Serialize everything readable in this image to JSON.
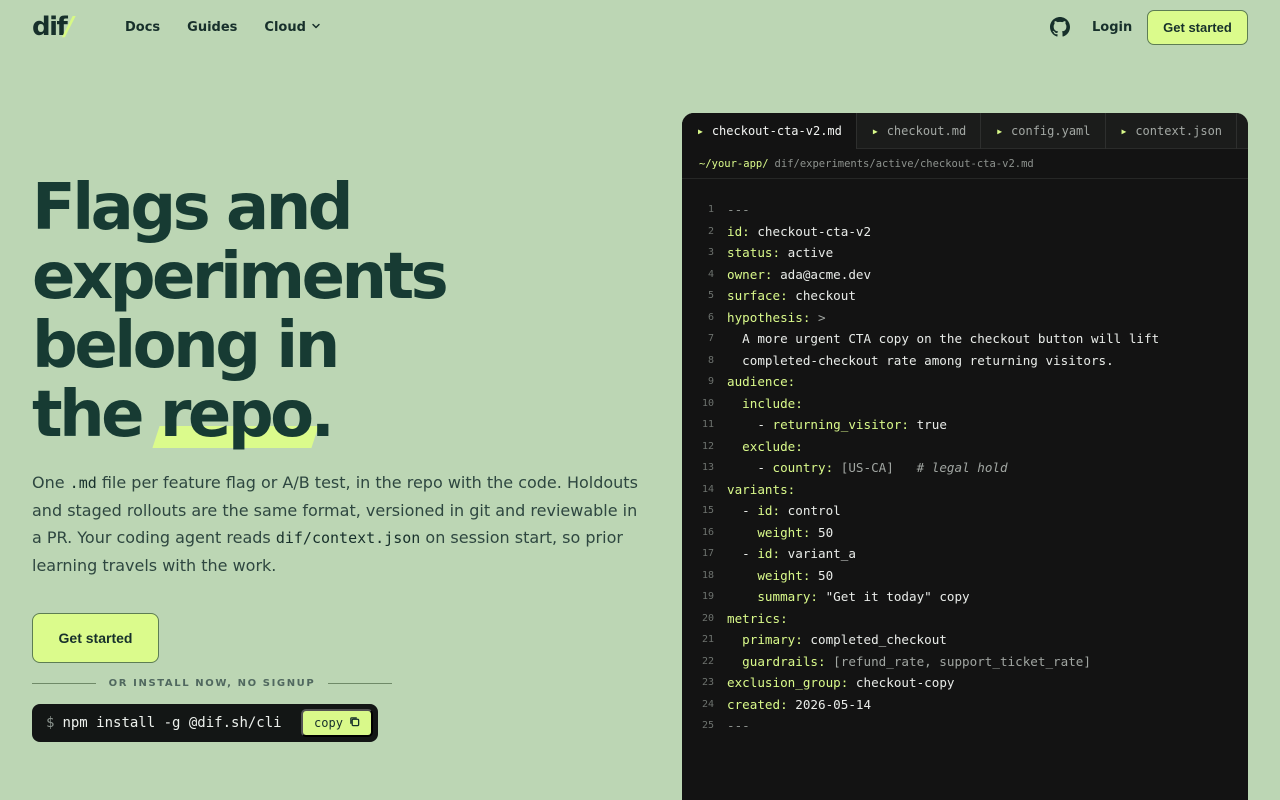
{
  "nav": {
    "logo": "dif",
    "logo_slash": "/",
    "links": [
      "Docs",
      "Guides",
      "Cloud"
    ],
    "login": "Login",
    "cta": "Get started",
    "github_icon": "github-icon"
  },
  "hero": {
    "title_lines": [
      "Flags and",
      "experiments",
      "belong in",
      "the "
    ],
    "title_highlight": "repo",
    "title_end": ".",
    "desc_1": "One ",
    "desc_code_1": ".md",
    "desc_2": " file per feature flag or A/B test, in the repo with the code. Holdouts and staged rollouts are the same format, versioned in git and reviewable in a PR. Your coding agent reads ",
    "desc_code_2": "dif/context.json",
    "desc_3": " on session start, so prior learning travels with the work.",
    "cta": "Get started",
    "or_text": "OR INSTALL NOW, NO SIGNUP",
    "install_prompt": "$",
    "install_cmd": "npm install -g @dif.sh/cli",
    "copy_label": "copy"
  },
  "editor": {
    "tabs": [
      "checkout-cta-v2.md",
      "checkout.md",
      "config.yaml",
      "context.json"
    ],
    "active_tab": 0,
    "breadcrumb_root": "~/your-app/",
    "breadcrumb_path": "dif/experiments/active/checkout-cta-v2.md",
    "lines": [
      {
        "n": "1",
        "parts": [
          [
            "d",
            "---"
          ]
        ]
      },
      {
        "n": "2",
        "parts": [
          [
            "k",
            "id:"
          ],
          [
            "t",
            " checkout-cta-v2"
          ]
        ]
      },
      {
        "n": "3",
        "parts": [
          [
            "k",
            "status:"
          ],
          [
            "t",
            " active"
          ]
        ]
      },
      {
        "n": "4",
        "parts": [
          [
            "k",
            "owner:"
          ],
          [
            "t",
            " ada@acme.dev"
          ]
        ]
      },
      {
        "n": "5",
        "parts": [
          [
            "k",
            "surface:"
          ],
          [
            "t",
            " checkout"
          ]
        ]
      },
      {
        "n": "6",
        "parts": [
          [
            "k",
            "hypothesis:"
          ],
          [
            "m",
            " >"
          ]
        ]
      },
      {
        "n": "7",
        "parts": [
          [
            "t",
            "  A more urgent CTA copy on the checkout button will lift"
          ]
        ]
      },
      {
        "n": "8",
        "parts": [
          [
            "t",
            "  completed-checkout rate among returning visitors."
          ]
        ]
      },
      {
        "n": "9",
        "parts": [
          [
            "k",
            "audience:"
          ]
        ]
      },
      {
        "n": "10",
        "parts": [
          [
            "k",
            "  include:"
          ]
        ]
      },
      {
        "n": "11",
        "parts": [
          [
            "t",
            "    - "
          ],
          [
            "k",
            "returning_visitor:"
          ],
          [
            "t",
            " true"
          ]
        ]
      },
      {
        "n": "12",
        "parts": [
          [
            "k",
            "  exclude:"
          ]
        ]
      },
      {
        "n": "13",
        "parts": [
          [
            "t",
            "    - "
          ],
          [
            "k",
            "country:"
          ],
          [
            "m",
            " [US-CA]   "
          ],
          [
            "c",
            "# legal hold"
          ]
        ]
      },
      {
        "n": "14",
        "parts": [
          [
            "k",
            "variants:"
          ]
        ]
      },
      {
        "n": "15",
        "parts": [
          [
            "t",
            "  - "
          ],
          [
            "k",
            "id:"
          ],
          [
            "t",
            " control"
          ]
        ]
      },
      {
        "n": "16",
        "parts": [
          [
            "k",
            "    weight:"
          ],
          [
            "t",
            " 50"
          ]
        ]
      },
      {
        "n": "17",
        "parts": [
          [
            "t",
            "  - "
          ],
          [
            "k",
            "id:"
          ],
          [
            "t",
            " variant_a"
          ]
        ]
      },
      {
        "n": "18",
        "parts": [
          [
            "k",
            "    weight:"
          ],
          [
            "t",
            " 50"
          ]
        ]
      },
      {
        "n": "19",
        "parts": [
          [
            "k",
            "    summary:"
          ],
          [
            "t",
            " \"Get it today\" copy"
          ]
        ]
      },
      {
        "n": "20",
        "parts": [
          [
            "k",
            "metrics:"
          ]
        ]
      },
      {
        "n": "21",
        "parts": [
          [
            "k",
            "  primary:"
          ],
          [
            "t",
            " completed_checkout"
          ]
        ]
      },
      {
        "n": "22",
        "parts": [
          [
            "k",
            "  guardrails:"
          ],
          [
            "m",
            " [refund_rate, support_ticket_rate]"
          ]
        ]
      },
      {
        "n": "23",
        "parts": [
          [
            "k",
            "exclusion_group:"
          ],
          [
            "t",
            " checkout-copy"
          ]
        ]
      },
      {
        "n": "24",
        "parts": [
          [
            "k",
            "created:"
          ],
          [
            "t",
            " 2026-05-14"
          ]
        ]
      },
      {
        "n": "25",
        "parts": [
          [
            "d",
            "---"
          ]
        ]
      }
    ]
  }
}
